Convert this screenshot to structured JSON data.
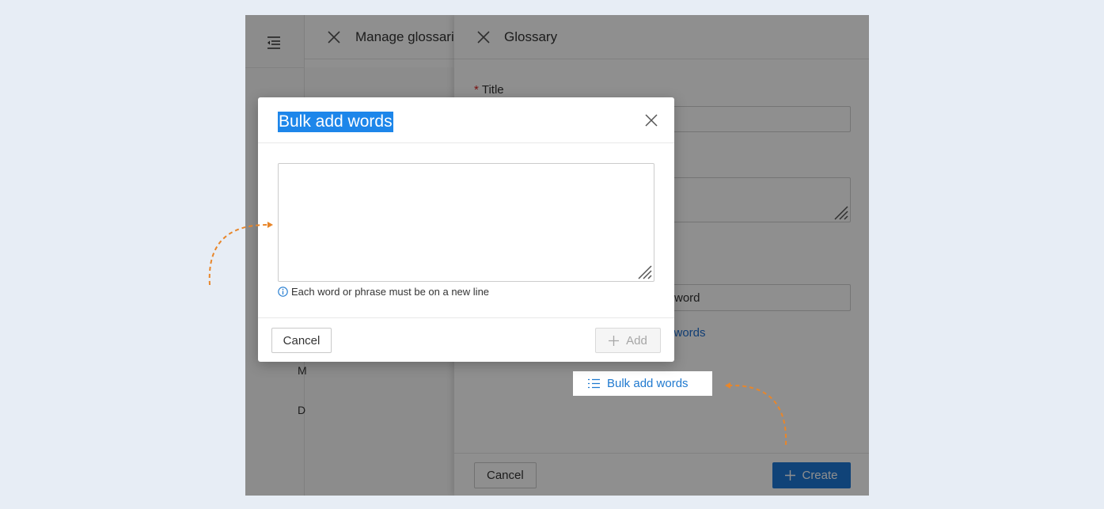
{
  "nav": {
    "menu_icon": "menu-fold-icon"
  },
  "manage_panel": {
    "title": "Manage glossaries",
    "close_icon": "close-icon",
    "nav_letters": [
      "M",
      "D"
    ]
  },
  "glossary_drawer": {
    "title": "Glossary",
    "close_icon": "close-icon",
    "title_label": "Title",
    "title_value": "",
    "word_input_placeholder": "word",
    "add_words_link": "d words",
    "bulk_add_label": "Bulk add words",
    "bulk_add_icon": "list-icon",
    "cancel_label": "Cancel",
    "create_label": "Create",
    "create_icon": "plus-icon"
  },
  "modal": {
    "title": "Bulk add words",
    "close_icon": "close-icon",
    "textarea_value": "",
    "hint": "Each word or phrase must be on a new line",
    "hint_icon": "info-circle-icon",
    "cancel_label": "Cancel",
    "add_label": "Add",
    "add_icon": "plus-icon"
  },
  "colors": {
    "accent": "#1e78d6",
    "highlight": "#1d86ea",
    "annotation_arrow": "#e8862a",
    "background": "#e7edf5"
  }
}
